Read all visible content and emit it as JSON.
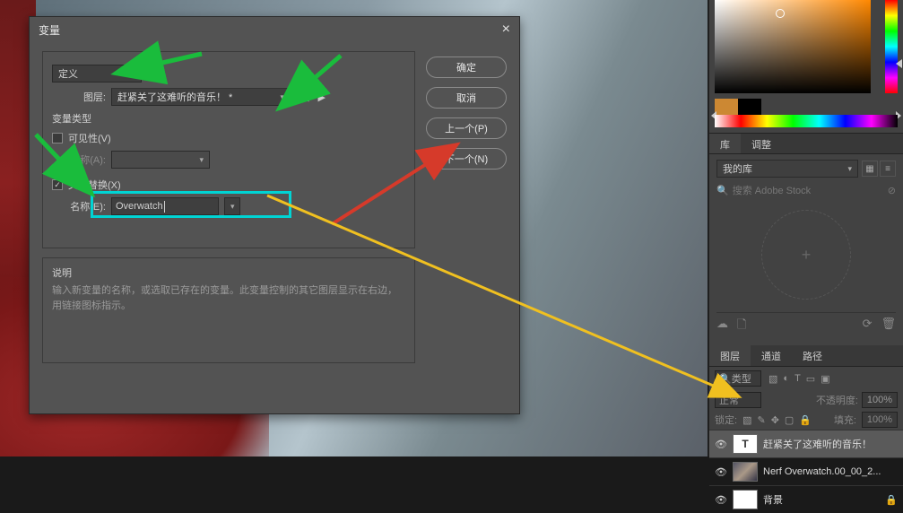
{
  "dialog": {
    "title": "变量",
    "def_label": "定义",
    "layer_label": "图层:",
    "layer_value": "赶紧关了这难听的音乐！ *",
    "var_type": "变量类型",
    "visibility": "可见性(V)",
    "nameA": "名称(A):",
    "text_replace": "文本替换(X)",
    "nameE": "名称(E):",
    "nameE_value": "Overwatch",
    "desc_title": "说明",
    "desc_text": "输入新变量的名称，或选取已存在的变量。此变量控制的其它图层显示在右边，用链接图标指示。",
    "btn_ok": "确定",
    "btn_cancel": "取消",
    "btn_prev": "上一个(P)",
    "btn_next": "下一个(N)"
  },
  "panels": {
    "lib_tab": "库",
    "adjust_tab": "调整",
    "mylibrary": "我的库",
    "search_placeholder": "搜索 Adobe Stock",
    "layers_tab": "图层",
    "channels_tab": "通道",
    "paths_tab": "路径",
    "filter_kind": "类型",
    "blend_normal": "正常",
    "opacity_label": "不透明度:",
    "opacity_val": "100%",
    "lock_label": "锁定:",
    "fill_label": "填充:",
    "fill_val": "100%",
    "layer1": "赶紧关了这难听的音乐！",
    "layer2": "Nerf Overwatch.00_00_2...",
    "layer3": "背景"
  }
}
